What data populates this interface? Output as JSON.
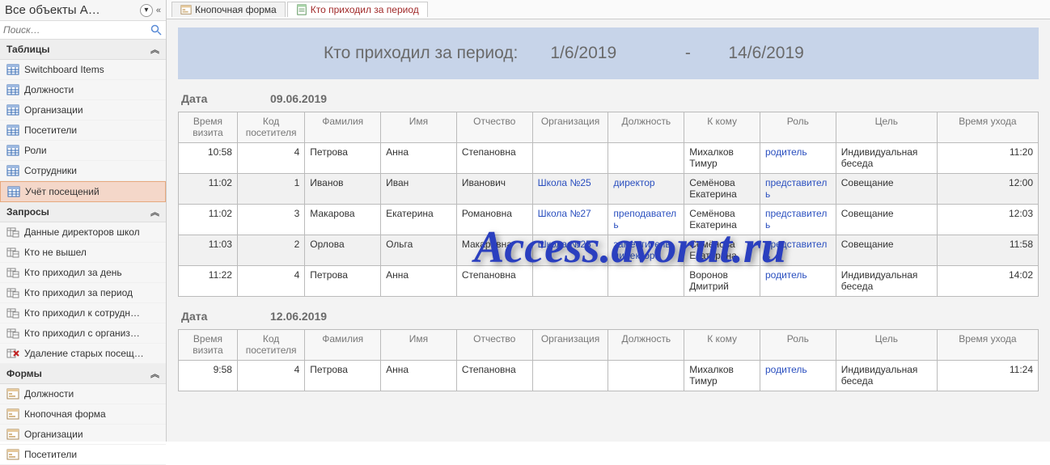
{
  "sidebar": {
    "title": "Все объекты A…",
    "search_placeholder": "Поиск…",
    "groups": [
      {
        "label": "Таблицы",
        "type": "table",
        "items": [
          {
            "label": "Switchboard Items",
            "selected": false
          },
          {
            "label": "Должности",
            "selected": false
          },
          {
            "label": "Организации",
            "selected": false
          },
          {
            "label": "Посетители",
            "selected": false
          },
          {
            "label": "Роли",
            "selected": false
          },
          {
            "label": "Сотрудники",
            "selected": false
          },
          {
            "label": "Учёт посещений",
            "selected": true
          }
        ]
      },
      {
        "label": "Запросы",
        "type": "query",
        "items": [
          {
            "label": "Данные директоров школ"
          },
          {
            "label": "Кто не вышел"
          },
          {
            "label": "Кто приходил за день"
          },
          {
            "label": "Кто приходил за период"
          },
          {
            "label": "Кто приходил к сотрудн…"
          },
          {
            "label": "Кто приходил с организ…"
          },
          {
            "label": "Удаление старых посещ…",
            "delete": true
          }
        ]
      },
      {
        "label": "Формы",
        "type": "form",
        "items": [
          {
            "label": "Должности"
          },
          {
            "label": "Кнопочная форма"
          },
          {
            "label": "Организации"
          },
          {
            "label": "Посетители"
          }
        ]
      }
    ]
  },
  "tabs": [
    {
      "label": "Кнопочная форма",
      "icon": "form",
      "active": false
    },
    {
      "label": "Кто приходил за период",
      "icon": "report",
      "active": true
    }
  ],
  "report": {
    "title": "Кто приходил за период:",
    "date_from": "1/6/2019",
    "dash": "-",
    "date_to": "14/6/2019",
    "date_label": "Дата",
    "columns": [
      "Время визита",
      "Код посетителя",
      "Фамилия",
      "Имя",
      "Отчество",
      "Организация",
      "Должность",
      "К кому",
      "Роль",
      "Цель",
      "Время ухода"
    ],
    "col_widths": [
      "70",
      "80",
      "90",
      "90",
      "90",
      "90",
      "90",
      "90",
      "90",
      "120",
      "120"
    ],
    "groups": [
      {
        "date": "09.06.2019",
        "rows": [
          {
            "time": "10:58",
            "code": "4",
            "fam": "Петрова",
            "name": "Анна",
            "patr": "Степановна",
            "org": "",
            "pos": "",
            "to": "Михалков Тимур",
            "role": "родитель",
            "purpose": "Индивидуальная беседа",
            "leave": "11:20"
          },
          {
            "time": "11:02",
            "code": "1",
            "fam": "Иванов",
            "name": "Иван",
            "patr": "Иванович",
            "org": "Школа №25",
            "pos": "директор",
            "to": "Семёнова Екатерина",
            "role": "представитель",
            "purpose": "Совещание",
            "leave": "12:00",
            "alt": true
          },
          {
            "time": "11:02",
            "code": "3",
            "fam": "Макарова",
            "name": "Екатерина",
            "patr": "Романовна",
            "org": "Школа №27",
            "pos": "преподаватель",
            "to": "Семёнова Екатерина",
            "role": "представитель",
            "purpose": "Совещание",
            "leave": "12:03"
          },
          {
            "time": "11:03",
            "code": "2",
            "fam": "Орлова",
            "name": "Ольга",
            "patr": "Макаровна",
            "org": "Школа №25",
            "pos": "заместитель директора",
            "to": "Семёнова Екатерина",
            "role": "представитель",
            "purpose": "Совещание",
            "leave": "11:58",
            "alt": true
          },
          {
            "time": "11:22",
            "code": "4",
            "fam": "Петрова",
            "name": "Анна",
            "patr": "Степановна",
            "org": "",
            "pos": "",
            "to": "Воронов Дмитрий",
            "role": "родитель",
            "purpose": "Индивидуальная беседа",
            "leave": "14:02"
          }
        ]
      },
      {
        "date": "12.06.2019",
        "rows": [
          {
            "time": "9:58",
            "code": "4",
            "fam": "Петрова",
            "name": "Анна",
            "patr": "Степановна",
            "org": "",
            "pos": "",
            "to": "Михалков Тимур",
            "role": "родитель",
            "purpose": "Индивидуальная беседа",
            "leave": "11:24"
          }
        ]
      }
    ]
  },
  "watermark": "Access.avorut.ru"
}
